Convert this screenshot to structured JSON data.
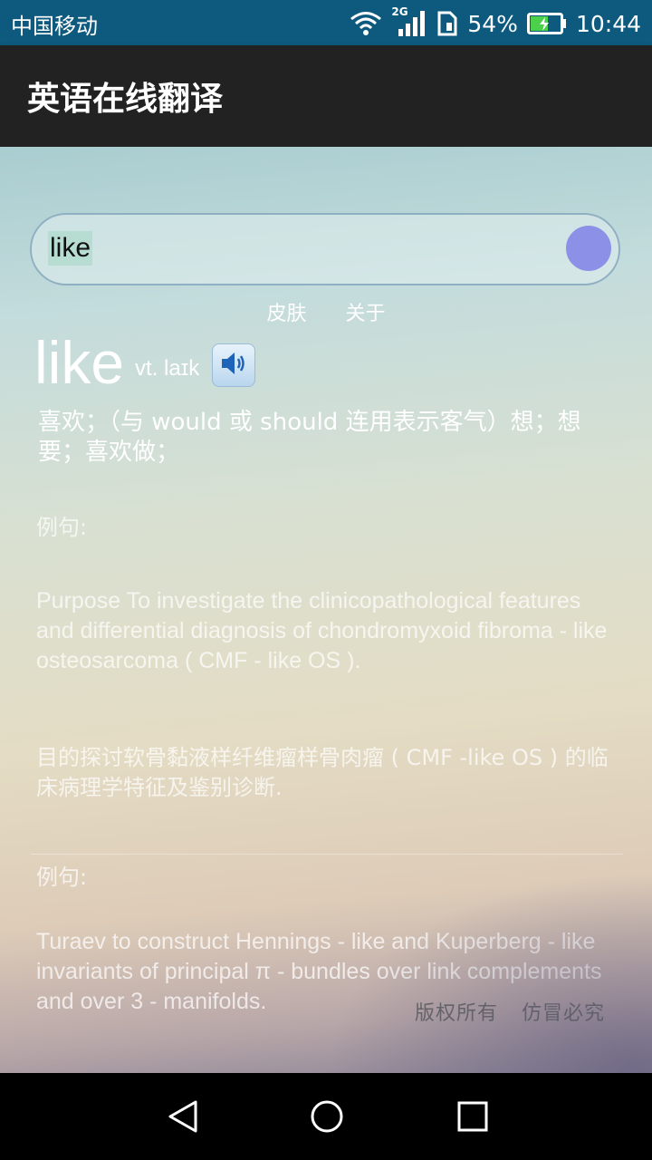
{
  "status_bar": {
    "carrier": "中国移动",
    "network": "2G",
    "battery": "54%",
    "time": "10:44"
  },
  "app": {
    "title": "英语在线翻译"
  },
  "search": {
    "value": "like"
  },
  "links": {
    "skin": "皮肤",
    "about": "关于"
  },
  "result": {
    "word": "like",
    "phonetic": "vt. laɪk",
    "definition": "喜欢；（与 would 或 should 连用表示客气）想；想要；喜欢做；"
  },
  "examples": [
    {
      "label": "例句:",
      "english": "Purpose To investigate the clinicopathological features and differential diagnosis of chondromyxoid fibroma - like osteosarcoma ( CMF - like OS ).",
      "chinese": "目的探讨软骨黏液样纤维瘤样骨肉瘤 ( CMF -like OS ) 的临床病理学特征及鉴别诊断."
    },
    {
      "label": "例句:",
      "english": "Turaev to construct Hennings - like and Kuperberg - like invariants of principal π - bundles over link complements and over 3 - manifolds."
    }
  ],
  "footer": {
    "rights": "版权所有",
    "piracy": "仿冒必究"
  },
  "colors": {
    "status_bar": "#0d5a7e",
    "app_bar": "#222222",
    "search_button": "#8c90e6"
  }
}
